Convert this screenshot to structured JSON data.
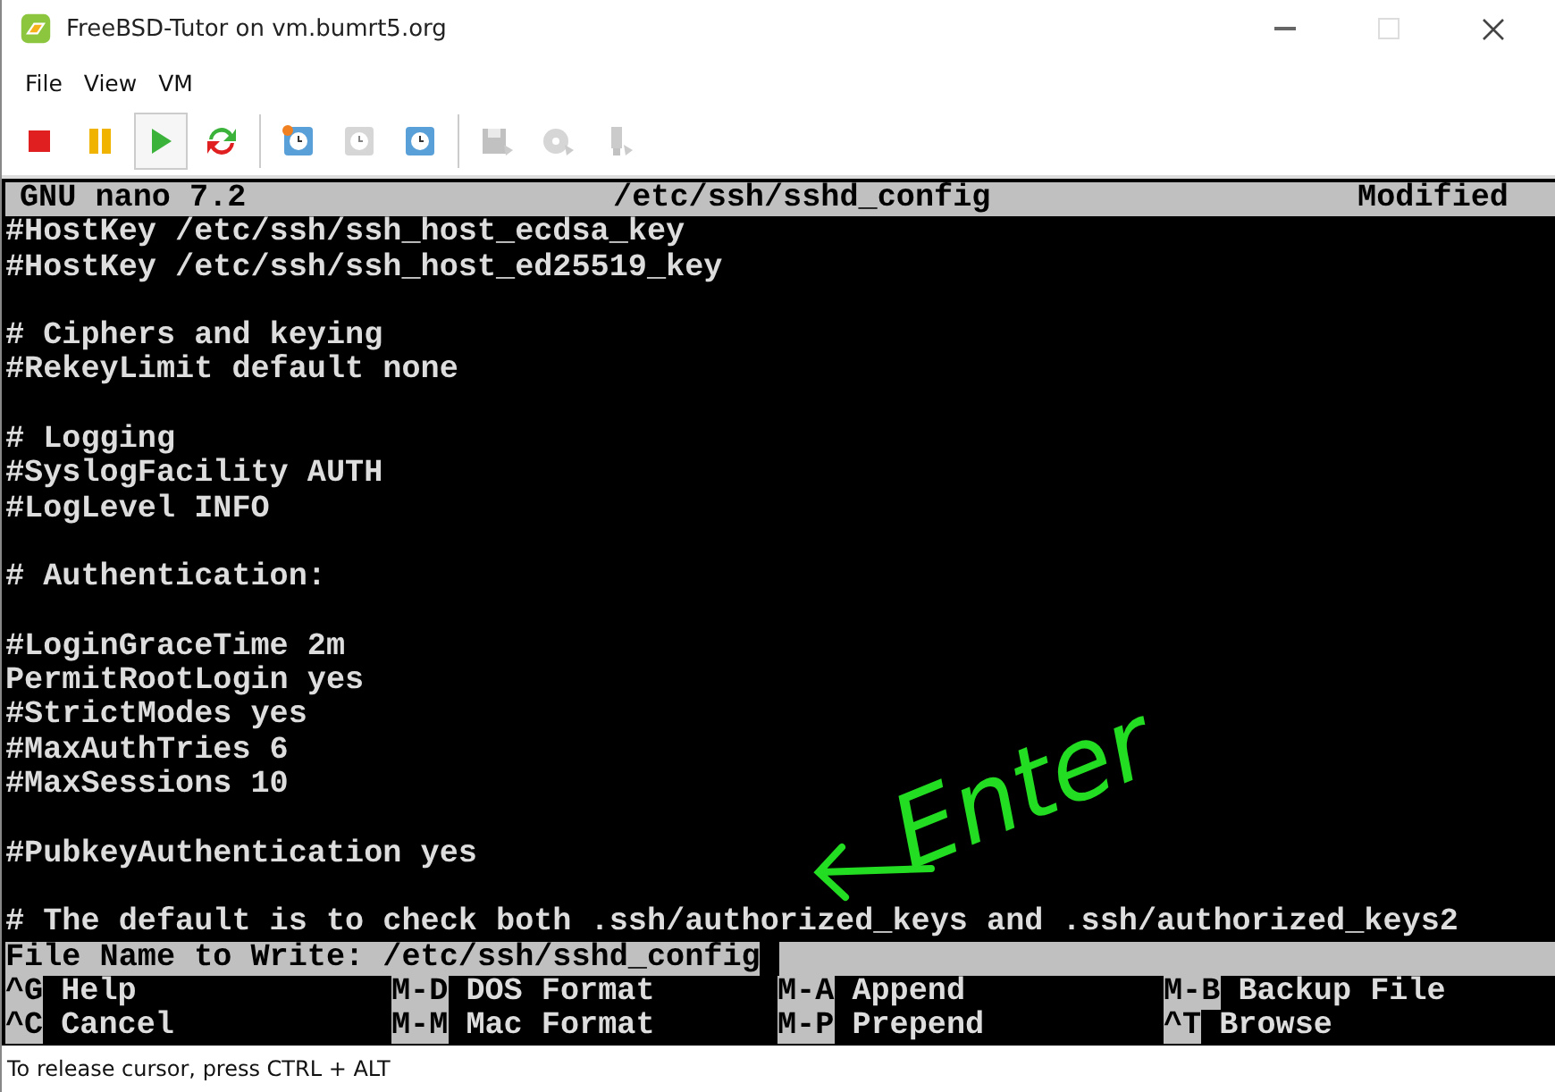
{
  "window": {
    "title": "FreeBSD-Tutor on vm.bumrt5.org"
  },
  "menu": [
    "File",
    "View",
    "VM"
  ],
  "toolbar": [
    {
      "kind": "stop",
      "disabled": false,
      "selected": false
    },
    {
      "kind": "pause",
      "disabled": false,
      "selected": false
    },
    {
      "kind": "play",
      "disabled": false,
      "selected": true
    },
    {
      "kind": "reset",
      "disabled": false,
      "selected": false
    },
    {
      "kind": "snapshot",
      "disabled": false,
      "selected": false
    },
    {
      "kind": "revert",
      "disabled": true,
      "selected": false
    },
    {
      "kind": "manager",
      "disabled": false,
      "selected": false
    },
    {
      "kind": "floppy",
      "disabled": true,
      "selected": false
    },
    {
      "kind": "disc",
      "disabled": true,
      "selected": false
    },
    {
      "kind": "usb",
      "disabled": true,
      "selected": false
    }
  ],
  "terminal": {
    "header": {
      "app": "GNU nano 7.2",
      "file": "/etc/ssh/sshd_config",
      "status": "Modified"
    },
    "lines": [
      {
        "kind": "text",
        "text": "#HostKey /etc/ssh/ssh_host_ecdsa_key"
      },
      {
        "kind": "text",
        "text": "#HostKey /etc/ssh/ssh_host_ed25519_key"
      },
      {
        "kind": "blank"
      },
      {
        "kind": "text",
        "text": "# Ciphers and keying"
      },
      {
        "kind": "text",
        "text": "#RekeyLimit default none"
      },
      {
        "kind": "blank"
      },
      {
        "kind": "text",
        "text": "# Logging"
      },
      {
        "kind": "text",
        "text": "#SyslogFacility AUTH"
      },
      {
        "kind": "text",
        "text": "#LogLevel INFO"
      },
      {
        "kind": "blank"
      },
      {
        "kind": "text",
        "text": "# Authentication:"
      },
      {
        "kind": "blank"
      },
      {
        "kind": "text",
        "text": "#LoginGraceTime 2m"
      },
      {
        "kind": "text",
        "text": "PermitRootLogin yes"
      },
      {
        "kind": "text",
        "text": "#StrictModes yes"
      },
      {
        "kind": "text",
        "text": "#MaxAuthTries 6"
      },
      {
        "kind": "text",
        "text": "#MaxSessions 10"
      },
      {
        "kind": "blank"
      },
      {
        "kind": "text",
        "text": "#PubkeyAuthentication yes"
      },
      {
        "kind": "blank"
      },
      {
        "kind": "text",
        "text": "# The default is to check both .ssh/authorized_keys and .ssh/authorized_keys2"
      }
    ],
    "prompt": {
      "label": "File Name to Write:",
      "value": "/etc/ssh/sshd_config"
    },
    "shortcuts": [
      [
        {
          "key": "^G",
          "label": "Help"
        },
        {
          "key": "M-D",
          "label": "DOS Format"
        },
        {
          "key": "M-A",
          "label": "Append"
        },
        {
          "key": "M-B",
          "label": "Backup File"
        }
      ],
      [
        {
          "key": "^C",
          "label": "Cancel"
        },
        {
          "key": "M-M",
          "label": "Mac Format"
        },
        {
          "key": "M-P",
          "label": "Prepend"
        },
        {
          "key": "^T",
          "label": "Browse"
        }
      ]
    ]
  },
  "annotation": {
    "text": "Enter"
  },
  "status_bar": "To release cursor, press CTRL + ALT"
}
